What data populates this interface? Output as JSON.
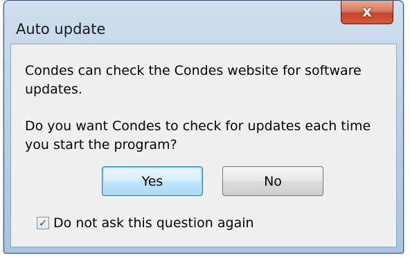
{
  "window": {
    "title": "Auto update",
    "close_label": "x"
  },
  "dialog": {
    "message_line1": "Condes can check the Condes website for software updates.",
    "message_line2": "Do you want Condes to check for updates each time you start the program?"
  },
  "buttons": {
    "yes_label": "Yes",
    "no_label": "No",
    "focused": "Yes"
  },
  "checkbox": {
    "label": "Do not ask this question again",
    "checked": true,
    "check_glyph": "✓"
  },
  "colors": {
    "titlebar": "#bcd3e8",
    "close_button": "#c7442b",
    "client_background": "#f0f0f0",
    "focus_border": "#3c7fb1"
  },
  "icons": {
    "close": "close-icon",
    "check": "checkmark-icon"
  }
}
